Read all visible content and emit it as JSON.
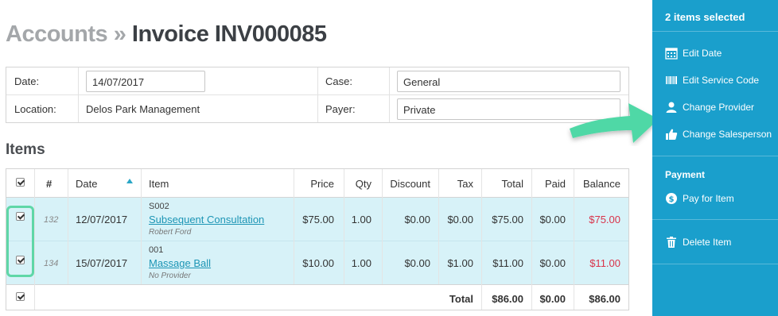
{
  "breadcrumb": {
    "parent": "Accounts",
    "separator": "»",
    "current": "Invoice INV000085"
  },
  "details": {
    "date_label": "Date:",
    "date_value": "14/07/2017",
    "case_label": "Case:",
    "case_value": "General",
    "location_label": "Location:",
    "location_value": "Delos Park Management",
    "payer_label": "Payer:",
    "payer_value": "Private"
  },
  "items_title": "Items",
  "table": {
    "columns": {
      "num": "#",
      "date": "Date",
      "item": "Item",
      "price": "Price",
      "qty": "Qty",
      "discount": "Discount",
      "tax": "Tax",
      "total": "Total",
      "paid": "Paid",
      "balance": "Balance"
    },
    "rows": [
      {
        "id": "132",
        "date": "12/07/2017",
        "code": "S002",
        "name": "Subsequent Consultation",
        "provider": "Robert Ford",
        "price": "$75.00",
        "qty": "1.00",
        "discount": "$0.00",
        "tax": "$0.00",
        "total": "$75.00",
        "paid": "$0.00",
        "balance": "$75.00"
      },
      {
        "id": "134",
        "date": "15/07/2017",
        "code": "001",
        "name": "Massage Ball",
        "provider": "No Provider",
        "price": "$10.00",
        "qty": "1.00",
        "discount": "$0.00",
        "tax": "$1.00",
        "total": "$11.00",
        "paid": "$0.00",
        "balance": "$11.00"
      }
    ],
    "footer": {
      "label": "Total",
      "total": "$86.00",
      "paid": "$0.00",
      "balance": "$86.00"
    }
  },
  "panel": {
    "title": "2 items selected",
    "actions": [
      {
        "label": "Edit Date",
        "icon": "calendar-icon"
      },
      {
        "label": "Edit Service Code",
        "icon": "barcode-icon"
      },
      {
        "label": "Change Provider",
        "icon": "user-icon"
      },
      {
        "label": "Change Salesperson",
        "icon": "thumbs-up-icon"
      }
    ],
    "payment_heading": "Payment",
    "pay_label": "Pay for Item",
    "delete_label": "Delete Item"
  },
  "colors": {
    "accent": "#1a9fcc",
    "selected_row": "#d7f2f8",
    "highlight": "#5fd7a7",
    "negative": "#d9334a",
    "link": "#1c95b5"
  }
}
